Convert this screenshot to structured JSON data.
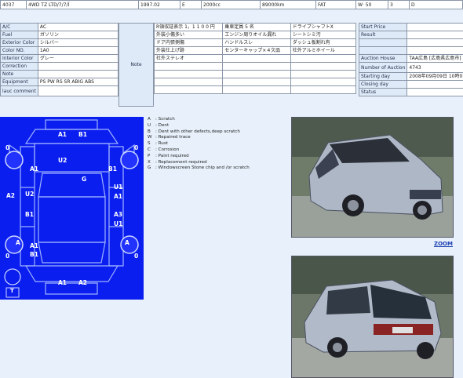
{
  "header_row": {
    "lot": "4037",
    "model": "4WD TZ LTD/7/7/Ï",
    "year": "1997.02",
    "grade_code": "E",
    "displacement": "2000cc",
    "mileage": "89000km",
    "transmission": "FAT",
    "color_code": "W· 50",
    "rating": "3",
    "score": "D"
  },
  "vehicle_info": {
    "labels": [
      "A/C",
      "Fuel",
      "Exterior Color",
      "Color NO.",
      "Interior Color",
      "Correction",
      "Note",
      "Equipment",
      "ìauc comment"
    ],
    "values": [
      "AC",
      "ガソリン",
      "シルバー",
      "1A0",
      "グレー",
      "",
      "",
      "PS PW RS SR ABIG ABS",
      ""
    ]
  },
  "note_label": "Note",
  "notes": [
    [
      "R領収証表示 1，1 1 0 0 円",
      "乗車定員 5 名",
      "ドライブシャフトX"
    ],
    [
      "外装小傷多い",
      "エンジン周りオイル漏れ",
      "シートシミ汚"
    ],
    [
      "ドア内張側傷",
      "ハンドルスレ",
      "ダッシュ板割れ有"
    ],
    [
      "外装仕上げ跡",
      "センターキャップ×４欠品",
      "社外アルミホイール"
    ],
    [
      "社外ステレオ",
      "",
      ""
    ],
    [
      "",
      "",
      ""
    ],
    [
      "",
      "",
      ""
    ],
    [
      "",
      "",
      ""
    ],
    [
      "",
      "",
      ""
    ]
  ],
  "auction_info": {
    "labels": [
      "Start Price",
      "Result",
      "",
      "",
      "Auction House",
      "Number of Auction",
      "Starting day",
      "Closing day",
      "Status"
    ],
    "values": [
      "",
      "",
      "",
      "",
      "TAA広島 [広島県広島市]",
      "4743",
      "2008年09月09日 10時07分",
      "",
      ""
    ]
  },
  "damage_codes": {
    "top": [
      "A1",
      "B1",
      "U2"
    ],
    "left": [
      "A1",
      "A2",
      "U2",
      "B1",
      "A",
      "A1",
      "B1"
    ],
    "center": [
      "G"
    ],
    "right": [
      "B1",
      "U1",
      "A1",
      "A3",
      "U1",
      "A"
    ],
    "bottom": [
      "A1",
      "A2"
    ],
    "wheels": [
      "0",
      "0",
      "0",
      "0"
    ],
    "spare": "T"
  },
  "legend": [
    {
      "code": "A",
      "text": "Scratch"
    },
    {
      "code": "U",
      "text": "Dent"
    },
    {
      "code": "B",
      "text": "Dent with other defects,deep scratch"
    },
    {
      "code": "W",
      "text": "Repaired trace"
    },
    {
      "code": "S",
      "text": "Rust"
    },
    {
      "code": "C",
      "text": "Corrosion"
    },
    {
      "code": "P",
      "text": "Paint required"
    },
    {
      "code": "X",
      "text": "Replacement required"
    },
    {
      "code": "G",
      "text": "Windowscreen Stone chip and /or scratch"
    }
  ],
  "zoom_label": "ZOOM",
  "colors": {
    "diagram_bg": "#0a1ef0",
    "diagram_line": "#9fb3ff",
    "page_bg": "#e8f1fb"
  }
}
